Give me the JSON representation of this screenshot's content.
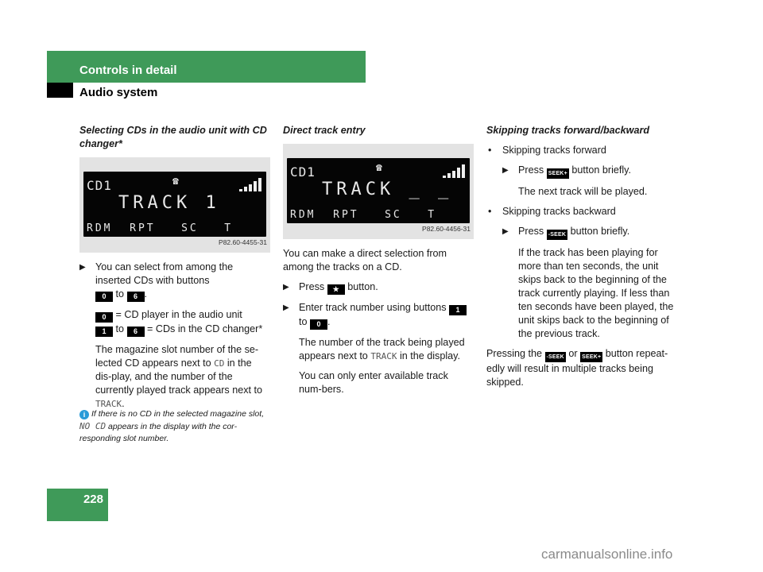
{
  "header": {
    "section": "Controls in detail",
    "subsection": "Audio system"
  },
  "page_number": "228",
  "colors": {
    "brand_green": "#3f9a59",
    "info_blue": "#2a9bd8"
  },
  "column1": {
    "heading": "Selecting CDs in the audio unit with CD changer*",
    "figure": {
      "lcd_cd": "CD1",
      "lcd_track": "TRACK  1",
      "lcd_bottom": "RDM  RPT   SC   T",
      "phone_icon": "☎",
      "code": "P82.60-4455-31"
    },
    "bullet1": {
      "text_a": "You can select from among the inserted CDs with buttons",
      "key_from": "0",
      "to": "to",
      "key_to": "6",
      "end": "."
    },
    "line2": {
      "key": "0",
      "text": "= CD player in the audio unit"
    },
    "line3": {
      "key_from": "1",
      "to": "to",
      "key_to": "6",
      "text": "= CDs in the CD changer*"
    },
    "para": {
      "a": "The magazine slot number of the se-lected CD appears next to",
      "cd": "CD",
      "b": "in the dis-play, and the number of the currently played track appears next to",
      "track": "TRACK",
      "c": "."
    },
    "note": {
      "a": "If there is no CD in the selected magazine slot,",
      "nocd": "NO CD",
      "b": "appears in the display with the cor-responding slot number."
    }
  },
  "column2": {
    "heading": "Direct track entry",
    "figure": {
      "lcd_cd": "CD1",
      "lcd_track": "TRACK _ _",
      "lcd_bottom": "RDM  RPT   SC   T",
      "phone_icon": "☎",
      "code": "P82.60-4456-31"
    },
    "intro": "You can make a direct selection from among the tracks on a CD.",
    "bullet1": {
      "press": "Press",
      "key": "★",
      "text": "button."
    },
    "bullet2": {
      "text": "Enter track number using buttons",
      "key_from": "1",
      "to": "to",
      "key_to": "0",
      "end": "."
    },
    "para1": {
      "a": "The number of the track being played appears next to",
      "track": "TRACK",
      "b": "in the display."
    },
    "para2": "You can only enter available track num-bers."
  },
  "column3": {
    "heading": "Skipping tracks forward/backward",
    "item1": {
      "label": "Skipping tracks forward",
      "press": "Press",
      "key": "SEEK+",
      "text": "button briefly.",
      "result": "The next track will be played."
    },
    "item2": {
      "label": "Skipping tracks backward",
      "press": "Press",
      "key": "-SEEK",
      "text": "button briefly.",
      "result": "If the track has been playing for more than ten seconds, the unit skips back to the beginning of the track currently playing. If less than ten seconds have been played, the unit skips back to the beginning of the previous track."
    },
    "closing": {
      "a": "Pressing the",
      "key1": "-SEEK",
      "or": "or",
      "key2": "SEEK+",
      "b": "button repeat-edly will result in multiple tracks being skipped."
    }
  },
  "watermark": "carmanualsonline.info"
}
